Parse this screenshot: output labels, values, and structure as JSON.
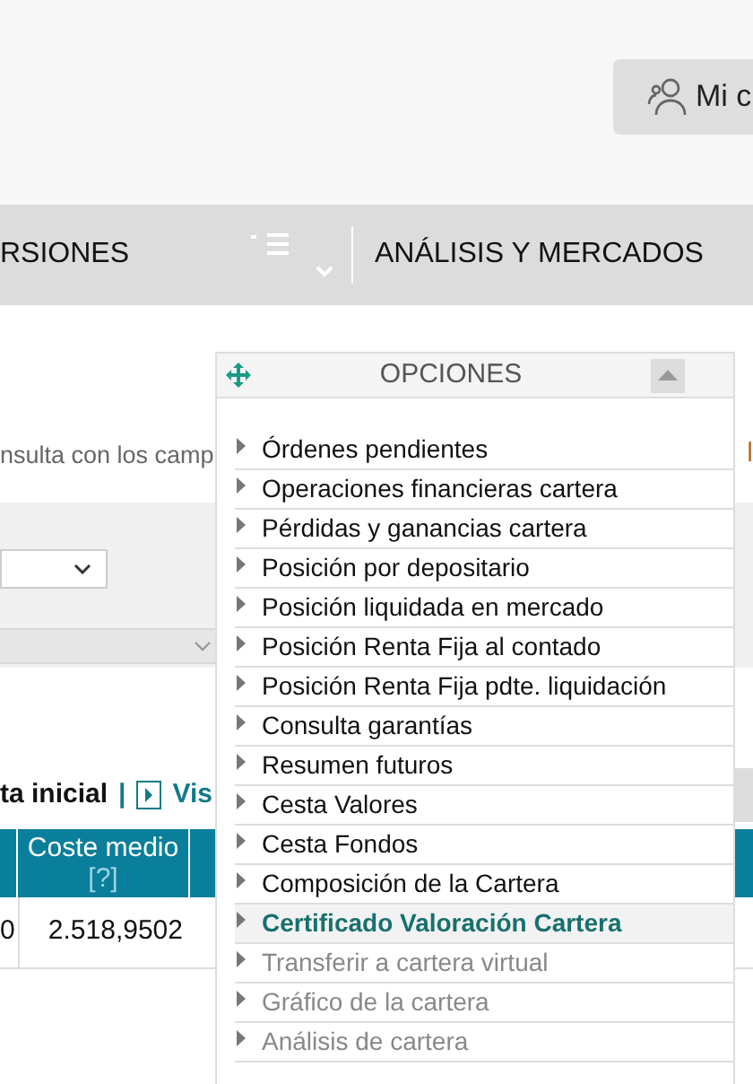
{
  "header": {
    "account_button": "Mi c"
  },
  "nav": {
    "items": [
      {
        "label": "RSIONES"
      },
      {
        "label": "ANÁLISIS Y MERCADOS"
      }
    ]
  },
  "intro_text": "nsulta con los camp",
  "intro_text_right": "l",
  "links": {
    "initial": "ta inicial",
    "separator": "|",
    "view": "Vis"
  },
  "table": {
    "columns": [
      {},
      {
        "label": "Coste medio",
        "help": "[?]"
      }
    ],
    "rows": [
      {
        "cells": [
          "0",
          "2.518,9502"
        ]
      }
    ]
  },
  "popup": {
    "title": "OPCIONES",
    "items": [
      {
        "label": "Órdenes pendientes",
        "selected": false,
        "disabled": false
      },
      {
        "label": "Operaciones financieras cartera",
        "selected": false,
        "disabled": false
      },
      {
        "label": "Pérdidas y ganancias cartera",
        "selected": false,
        "disabled": false
      },
      {
        "label": "Posición por depositario",
        "selected": false,
        "disabled": false
      },
      {
        "label": "Posición liquidada en mercado",
        "selected": false,
        "disabled": false
      },
      {
        "label": "Posición Renta Fija al contado",
        "selected": false,
        "disabled": false
      },
      {
        "label": "Posición Renta Fija pdte. liquidación",
        "selected": false,
        "disabled": false
      },
      {
        "label": "Consulta garantías",
        "selected": false,
        "disabled": false
      },
      {
        "label": "Resumen futuros",
        "selected": false,
        "disabled": false
      },
      {
        "label": "Cesta Valores",
        "selected": false,
        "disabled": false
      },
      {
        "label": "Cesta Fondos",
        "selected": false,
        "disabled": false
      },
      {
        "label": "Composición de la Cartera",
        "selected": false,
        "disabled": false
      },
      {
        "label": "Certificado Valoración Cartera",
        "selected": true,
        "disabled": false
      },
      {
        "label": "Transferir a cartera virtual",
        "selected": false,
        "disabled": true
      },
      {
        "label": "Gráfico de la cartera",
        "selected": false,
        "disabled": true
      },
      {
        "label": "Análisis de cartera",
        "selected": false,
        "disabled": true
      }
    ]
  }
}
